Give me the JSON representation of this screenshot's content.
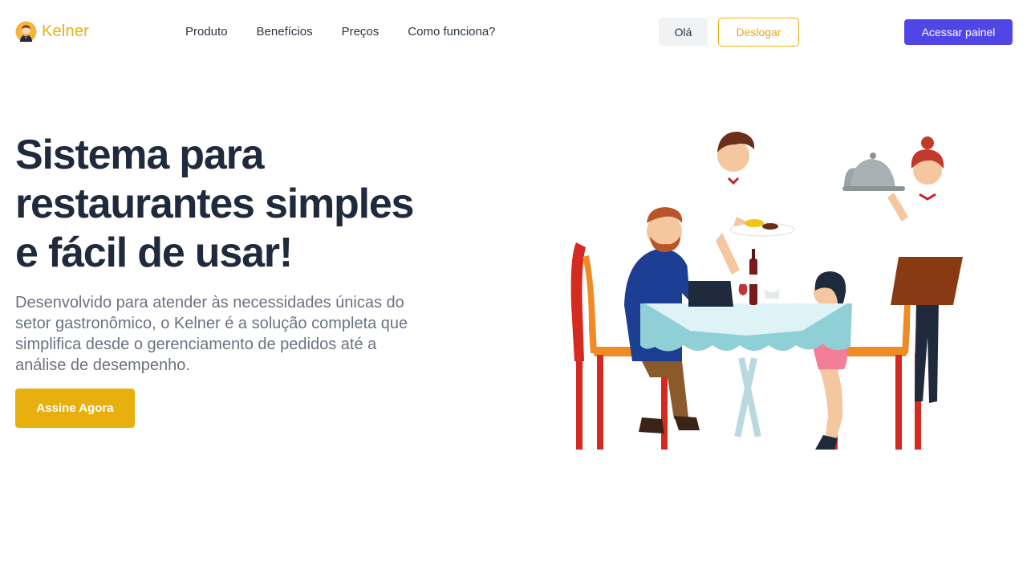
{
  "brand": {
    "name": "Kelner",
    "logo_icon": "waiter-avatar-icon",
    "color": "#e7b00f"
  },
  "nav": {
    "links": [
      "Produto",
      "Benefícios",
      "Preços",
      "Como funciona?"
    ]
  },
  "user": {
    "greeting": "Olá",
    "logout_label": "Deslogar",
    "panel_label": "Acessar painel"
  },
  "hero": {
    "title_lines": [
      "Sistema para",
      "restaurantes simples",
      "e fácil de usar!"
    ],
    "description_lines": [
      "Desenvolvido para atender às necessidades únicas do",
      "setor gastronômico, o Kelner é a solução completa que",
      "simplifica desde o gerenciamento de pedidos até a",
      "análise de desempenho."
    ],
    "cta_label": "Assine Agora"
  },
  "illustration": {
    "icon": "restaurant-scene-illustration"
  },
  "colors": {
    "accent": "#e7b00f",
    "primary": "#4f46e5",
    "heading": "#1f2a3c",
    "body_text": "#6b7280",
    "badge_bg": "#f1f2f4"
  }
}
